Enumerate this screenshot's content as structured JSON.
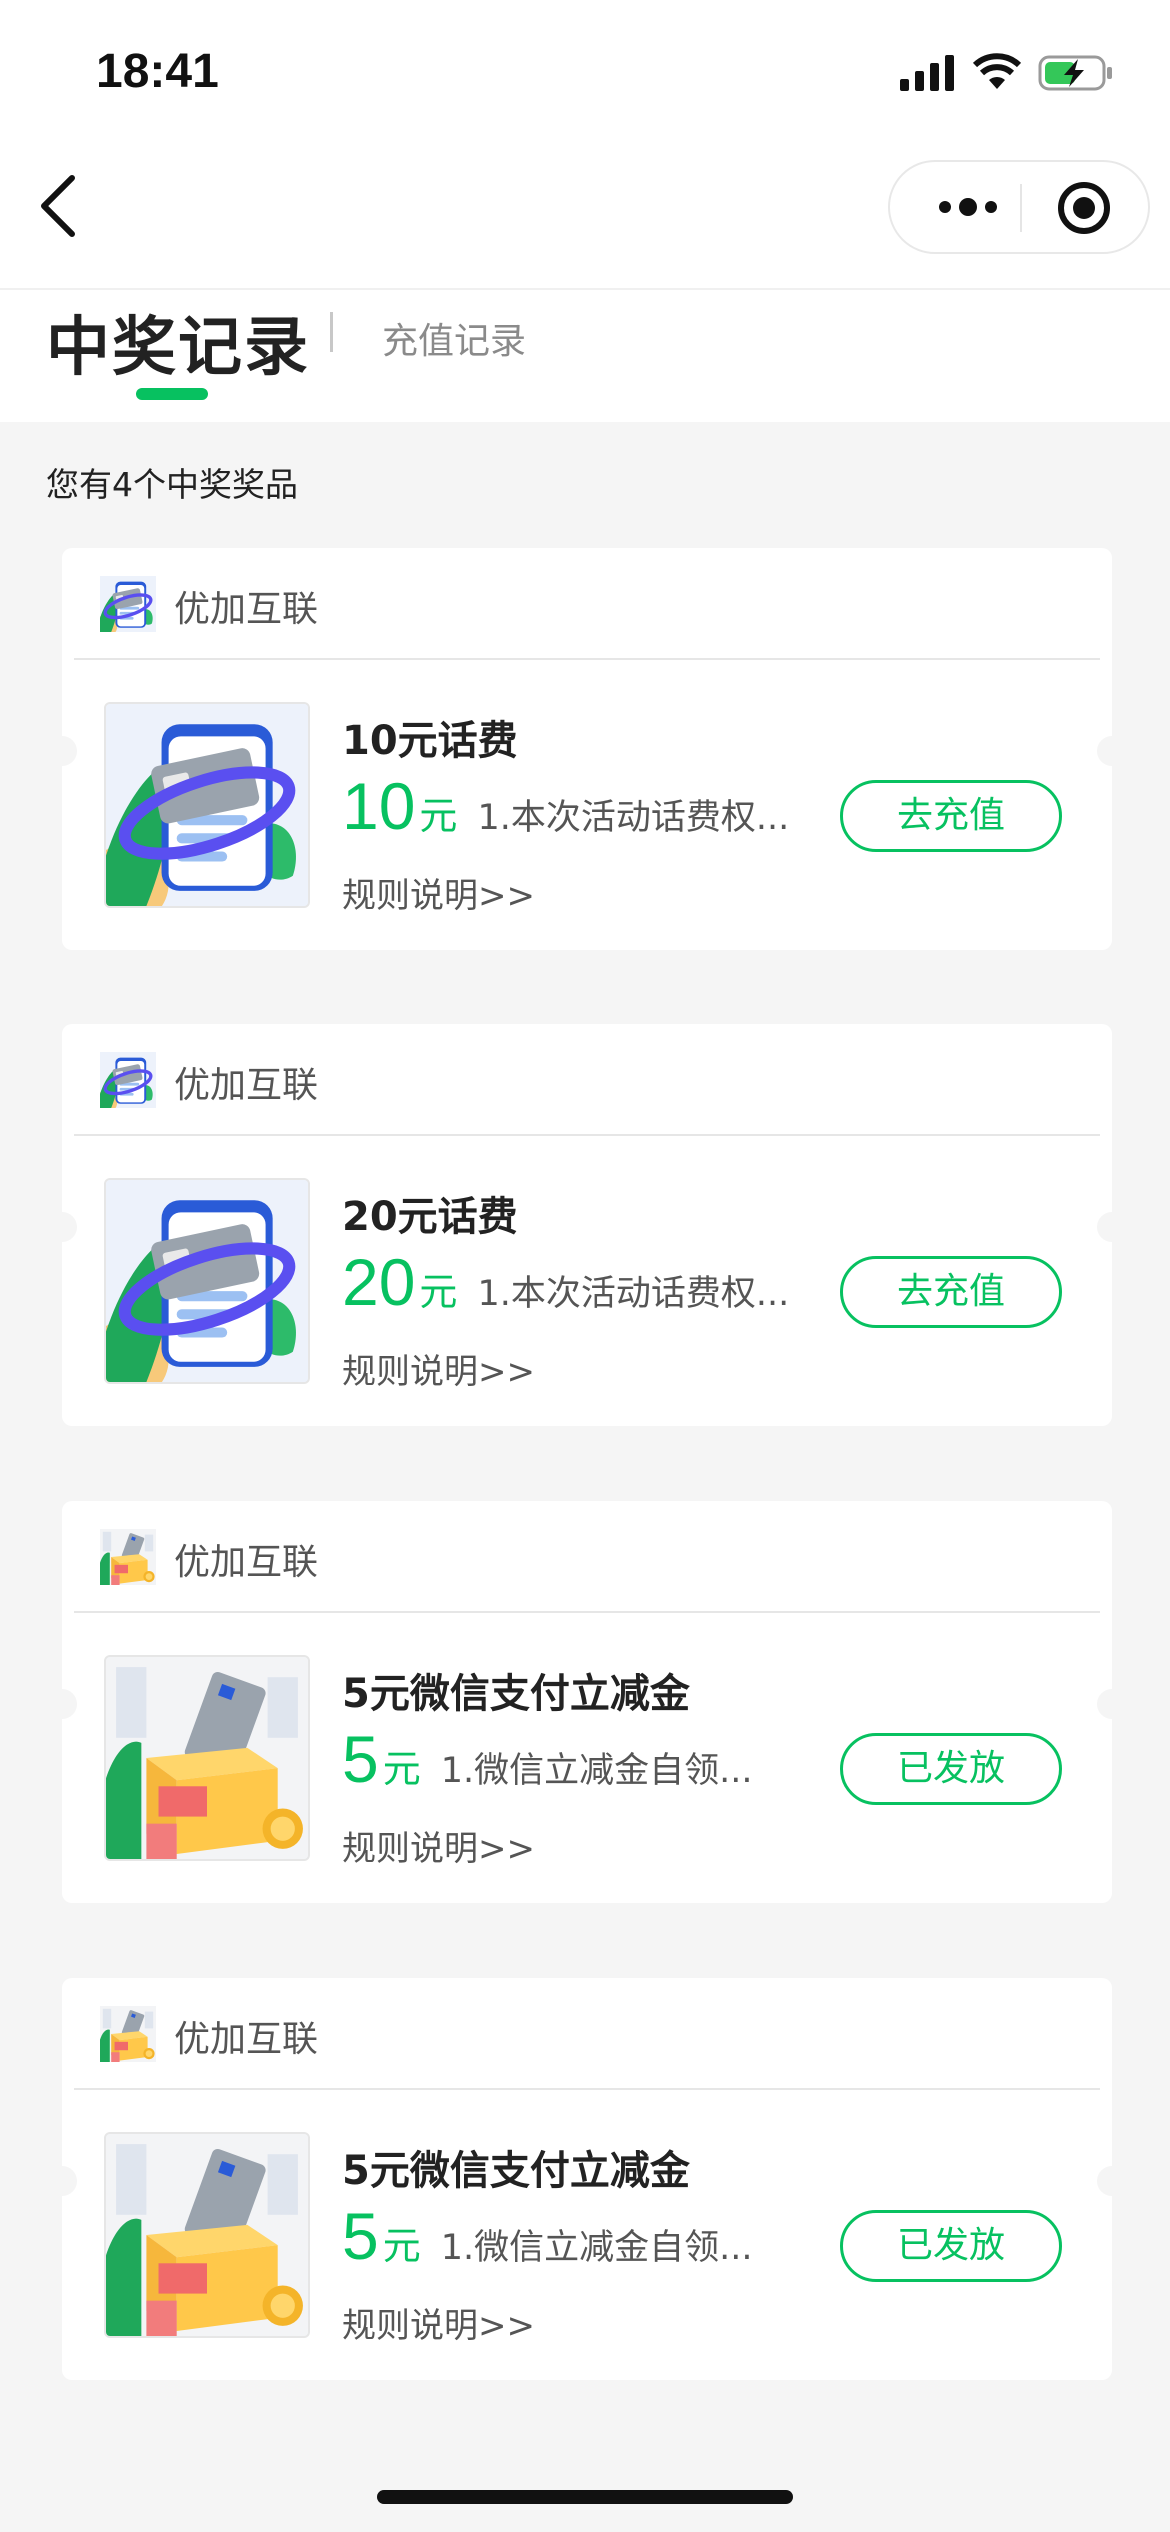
{
  "status_bar": {
    "time": "18:41"
  },
  "tabs": {
    "active": "中奖记录",
    "other": "充值记录"
  },
  "summary": "您有4个中奖奖品",
  "colors": {
    "accent": "#07c160",
    "background": "#f5f5f5",
    "card": "#ffffff"
  },
  "prizes": [
    {
      "brand": "优加互联",
      "name": "10元话费",
      "amount": "10",
      "unit": "元",
      "desc": "1.本次活动话费权...",
      "rules": "规则说明>>",
      "action": "去充值",
      "image": "phone-card-icon"
    },
    {
      "brand": "优加互联",
      "name": "20元话费",
      "amount": "20",
      "unit": "元",
      "desc": "1.本次活动话费权...",
      "rules": "规则说明>>",
      "action": "去充值",
      "image": "phone-card-icon"
    },
    {
      "brand": "优加互联",
      "name": "5元微信支付立减金",
      "amount": "5",
      "unit": "元",
      "desc": "1.微信立减金自领...",
      "rules": "规则说明>>",
      "action": "已发放",
      "image": "money-box-icon"
    },
    {
      "brand": "优加互联",
      "name": "5元微信支付立减金",
      "amount": "5",
      "unit": "元",
      "desc": "1.微信立减金自领...",
      "rules": "规则说明>>",
      "action": "已发放",
      "image": "money-box-icon"
    }
  ]
}
